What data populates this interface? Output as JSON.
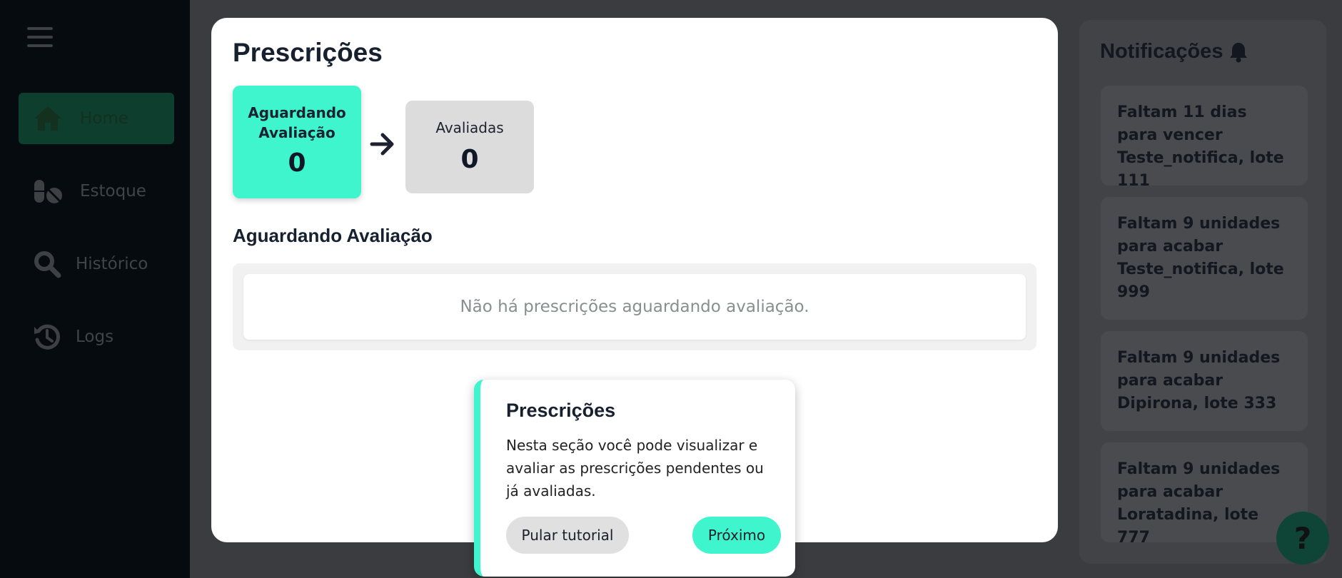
{
  "sidebar": {
    "items": [
      {
        "label": "Home",
        "icon": "home-icon",
        "active": true
      },
      {
        "label": "Estoque",
        "icon": "pills-icon"
      },
      {
        "label": "Histórico",
        "icon": "search-icon"
      },
      {
        "label": "Logs",
        "icon": "history-icon"
      }
    ]
  },
  "main": {
    "title": "Prescrições",
    "stats": [
      {
        "label": "Aguardando Avaliação",
        "value": "0"
      },
      {
        "label": "Avaliadas",
        "value": "0"
      }
    ],
    "section_title": "Aguardando Avaliação",
    "empty_message": "Não há prescrições aguardando avaliação."
  },
  "notifications": {
    "title": "Notificações",
    "items": [
      "Faltam 11 dias para vencer Teste_notifica, lote 111",
      "Faltam 9 unidades para acabar Teste_notifica, lote 999",
      "Faltam 9 unidades para acabar Dipirona, lote 333",
      "Faltam 9 unidades para acabar Loratadina, lote 777"
    ]
  },
  "help": {
    "label": "?"
  },
  "tutorial": {
    "title": "Prescrições",
    "text": "Nesta seção você pode visualizar e avaliar as prescrições pendentes ou já avaliadas.",
    "skip_label": "Pular tutorial",
    "next_label": "Próximo"
  },
  "colors": {
    "accent": "#3ff5cd",
    "sidebar_bg": "#050b0f",
    "overlay_bg": "#3b3c3f"
  }
}
